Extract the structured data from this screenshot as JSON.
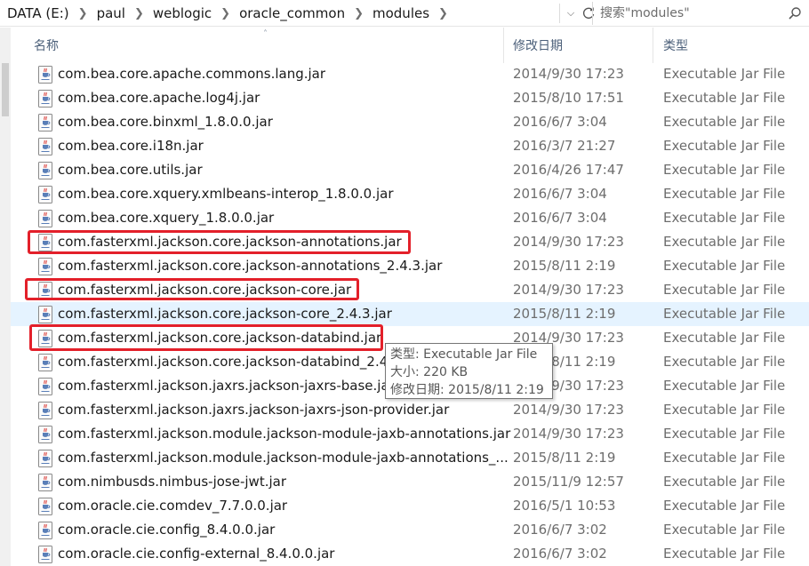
{
  "address_bar": {
    "crumbs": [
      "DATA (E:)",
      "paul",
      "weblogic",
      "oracle_common",
      "modules"
    ],
    "search_placeholder": "搜索\"modules\""
  },
  "columns": {
    "name": "名称",
    "date": "修改日期",
    "type": "类型"
  },
  "files": [
    {
      "name": "com.bea.core.apache.commons.lang.jar",
      "date": "2014/9/30 17:23",
      "type": "Executable Jar File"
    },
    {
      "name": "com.bea.core.apache.log4j.jar",
      "date": "2015/8/10 17:51",
      "type": "Executable Jar File"
    },
    {
      "name": "com.bea.core.binxml_1.8.0.0.jar",
      "date": "2016/6/7 3:04",
      "type": "Executable Jar File"
    },
    {
      "name": "com.bea.core.i18n.jar",
      "date": "2016/3/7 21:27",
      "type": "Executable Jar File"
    },
    {
      "name": "com.bea.core.utils.jar",
      "date": "2016/4/26 17:47",
      "type": "Executable Jar File"
    },
    {
      "name": "com.bea.core.xquery.xmlbeans-interop_1.8.0.0.jar",
      "date": "2016/6/7 3:04",
      "type": "Executable Jar File"
    },
    {
      "name": "com.bea.core.xquery_1.8.0.0.jar",
      "date": "2016/6/7 3:04",
      "type": "Executable Jar File"
    },
    {
      "name": "com.fasterxml.jackson.core.jackson-annotations.jar",
      "date": "2014/9/30 17:23",
      "type": "Executable Jar File"
    },
    {
      "name": "com.fasterxml.jackson.core.jackson-annotations_2.4.3.jar",
      "date": "2015/8/11 2:19",
      "type": "Executable Jar File"
    },
    {
      "name": "com.fasterxml.jackson.core.jackson-core.jar",
      "date": "2014/9/30 17:23",
      "type": "Executable Jar File"
    },
    {
      "name": "com.fasterxml.jackson.core.jackson-core_2.4.3.jar",
      "date": "2015/8/11 2:19",
      "type": "Executable Jar File"
    },
    {
      "name": "com.fasterxml.jackson.core.jackson-databind.jar",
      "date": "2014/9/30 17:23",
      "type": "Executable Jar File"
    },
    {
      "name": "com.fasterxml.jackson.core.jackson-databind_2.4.3",
      "date": "2015/8/11 2:19",
      "type": "Executable Jar File"
    },
    {
      "name": "com.fasterxml.jackson.jaxrs.jackson-jaxrs-base.jar",
      "date": "2014/9/30 17:23",
      "type": "Executable Jar File"
    },
    {
      "name": "com.fasterxml.jackson.jaxrs.jackson-jaxrs-json-provider.jar",
      "date": "2014/9/30 17:23",
      "type": "Executable Jar File"
    },
    {
      "name": "com.fasterxml.jackson.module.jackson-module-jaxb-annotations.jar",
      "date": "2014/9/30 17:23",
      "type": "Executable Jar File"
    },
    {
      "name": "com.fasterxml.jackson.module.jackson-module-jaxb-annotations_...",
      "date": "2015/8/11 2:19",
      "type": "Executable Jar File"
    },
    {
      "name": "com.nimbusds.nimbus-jose-jwt.jar",
      "date": "2015/11/9 12:57",
      "type": "Executable Jar File"
    },
    {
      "name": "com.oracle.cie.comdev_7.7.0.0.jar",
      "date": "2016/5/1 10:53",
      "type": "Executable Jar File"
    },
    {
      "name": "com.oracle.cie.config_8.4.0.0.jar",
      "date": "2016/6/7 3:02",
      "type": "Executable Jar File"
    },
    {
      "name": "com.oracle.cie.config-external_8.4.0.0.jar",
      "date": "2016/6/7 3:02",
      "type": "Executable Jar File"
    }
  ],
  "hover_row": 10,
  "highlighted_rows": [
    7,
    9,
    11
  ],
  "tooltip": {
    "type_line": "类型: Executable Jar File",
    "size_line": "大小: 220 KB",
    "date_line": "修改日期: 2015/8/11 2:19"
  },
  "colors": {
    "highlight_box": "#e3202a",
    "hover_row": "#e5f3ff",
    "header_text": "#4c607a"
  },
  "icons": {
    "file": "java-jar-icon",
    "search": "search-icon",
    "refresh": "refresh-icon"
  }
}
